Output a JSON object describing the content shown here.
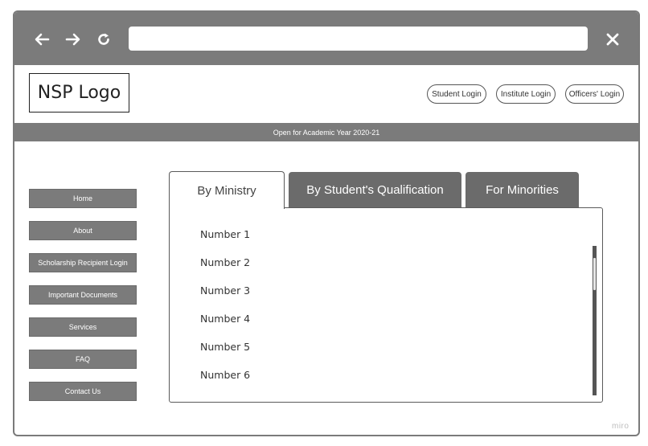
{
  "browser": {
    "back_icon": "arrow-left-icon",
    "forward_icon": "arrow-right-icon",
    "reload_icon": "reload-icon",
    "close_icon": "close-icon",
    "url_value": "",
    "url_placeholder": ""
  },
  "header": {
    "logo_text": "NSP Logo",
    "login_buttons": [
      "Student Login",
      "Institute Login",
      "Officers' Login"
    ]
  },
  "banner": {
    "text": "Open for Academic Year 2020-21"
  },
  "sidebar": {
    "items": [
      "Home",
      "About",
      "Scholarship Recipient Login",
      "Important Documents",
      "Services",
      "FAQ",
      "Contact Us"
    ]
  },
  "tabs": {
    "items": [
      "By Ministry",
      "By Student's Qualification",
      "For Minorities"
    ],
    "active": "By Ministry"
  },
  "list": {
    "items": [
      "Number 1",
      "Number 2",
      "Number 3",
      "Number 4",
      "Number 5",
      "Number 6"
    ]
  },
  "watermark": "miro",
  "colors": {
    "chrome": "#7b7b7b",
    "tab_inactive": "#6b6b6b",
    "button_grey": "#7b7b7b"
  }
}
